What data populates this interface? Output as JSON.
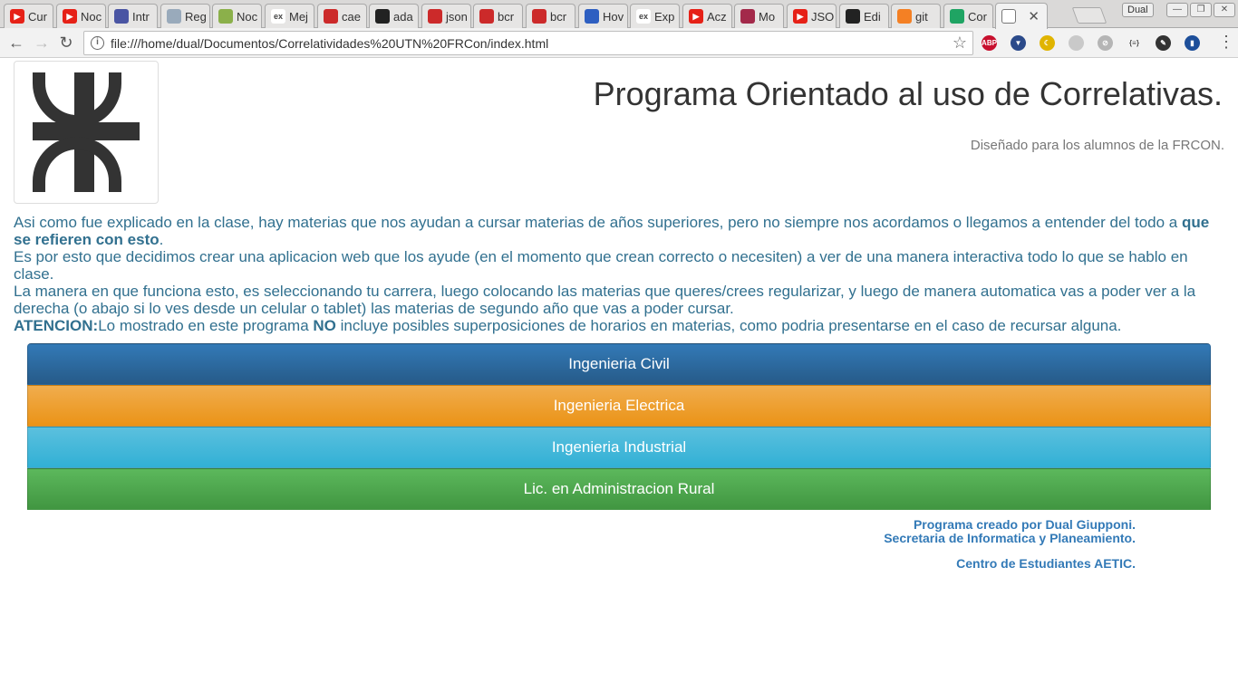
{
  "browser": {
    "tabs": [
      {
        "title": "Cur",
        "icon": "youtube-icon",
        "color": "#e62117"
      },
      {
        "title": "Noc",
        "icon": "youtube-icon",
        "color": "#e62117"
      },
      {
        "title": "Intr",
        "icon": "page-icon",
        "color": "#4a55a3"
      },
      {
        "title": "Reg",
        "icon": "page-icon",
        "color": "#9ab"
      },
      {
        "title": "Noc",
        "icon": "page-icon",
        "color": "#8bb04a"
      },
      {
        "title": "Mej",
        "icon": "ex-icon",
        "color": "#444"
      },
      {
        "title": "cae",
        "icon": "page-icon",
        "color": "#cc2a2a"
      },
      {
        "title": "ada",
        "icon": "github-icon",
        "color": "#222"
      },
      {
        "title": "json",
        "icon": "page-icon",
        "color": "#cc2a2a"
      },
      {
        "title": "bcr",
        "icon": "page-icon",
        "color": "#cc2a2a"
      },
      {
        "title": "bcr",
        "icon": "page-icon",
        "color": "#cc2a2a"
      },
      {
        "title": "Hov",
        "icon": "page-icon",
        "color": "#2e5fc1"
      },
      {
        "title": "Exp",
        "icon": "ex-icon",
        "color": "#444"
      },
      {
        "title": "Acz",
        "icon": "youtube-icon",
        "color": "#e62117"
      },
      {
        "title": "Mo",
        "icon": "page-icon",
        "color": "#a3294a"
      },
      {
        "title": "JSO",
        "icon": "youtube-icon",
        "color": "#e62117"
      },
      {
        "title": "Edi",
        "icon": "github-icon",
        "color": "#222"
      },
      {
        "title": "git",
        "icon": "page-icon",
        "color": "#f48024"
      },
      {
        "title": "Cor",
        "icon": "drive-icon",
        "color": "#1fa463"
      },
      {
        "title": "",
        "icon": "page-icon",
        "color": "#ffffff"
      }
    ],
    "profile": "Dual",
    "url": "file:///home/dual/Documentos/Correlatividades%20UTN%20FRCon/index.html",
    "extensions": [
      {
        "label": "ABP",
        "color": "#c8102e"
      },
      {
        "label": "▼",
        "color": "#2b4a8a"
      },
      {
        "label": "☾",
        "color": "#e0b400"
      },
      {
        "label": "",
        "color": "#c9c9c9"
      },
      {
        "label": "⊘",
        "color": "#b5b5b5"
      },
      {
        "label": "{≡}",
        "color": "#f2f2f2"
      },
      {
        "label": "✎",
        "color": "#333333"
      },
      {
        "label": "▮",
        "color": "#1d4f9a"
      }
    ]
  },
  "page": {
    "title": "Programa Orientado al uso de Correlativas.",
    "subtitle": "Diseñado para los alumnos de la FRCON.",
    "intro": {
      "p1_a": "Asi como fue explicado en la clase, hay materias que nos ayudan a cursar materias de años superiores, pero no siempre nos acordamos o llegamos a entender del todo a ",
      "p1_bold": "que se refieren con esto",
      "p1_b": ".",
      "p2": "Es por esto que decidimos crear una aplicacion web que los ayude (en el momento que crean correcto o necesiten) a ver de una manera interactiva todo lo que se hablo en clase.",
      "p3": "La manera en que funciona esto, es seleccionando tu carrera, luego colocando las materias que queres/crees regularizar, y luego de manera automatica vas a poder ver a la derecha (o abajo si lo ves desde un celular o tablet) las materias de segundo año que vas a poder cursar.",
      "p4_label": "ATENCION:",
      "p4_a": "Lo mostrado en este programa ",
      "p4_bold": "NO",
      "p4_b": " incluye posibles superposiciones de horarios en materias, como podria presentarse en el caso de recursar alguna."
    },
    "careers": [
      {
        "label": "Ingenieria Civil",
        "color": "#2b6aa8"
      },
      {
        "label": "Ingenieria Electrica",
        "color": "#ee9f2f"
      },
      {
        "label": "Ingenieria Industrial",
        "color": "#46b8dc"
      },
      {
        "label": "Lic. en Administracion Rural",
        "color": "#4ea84e"
      }
    ],
    "footer": {
      "line1": "Programa creado por Dual Giupponi.",
      "line2": "Secretaria de Informatica y Planeamiento.",
      "line3": "Centro de Estudiantes AETIC."
    }
  }
}
